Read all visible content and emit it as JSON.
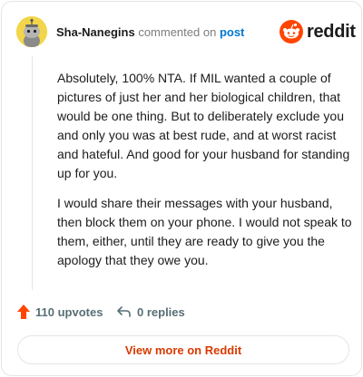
{
  "header": {
    "username": "Sha-Nanegins",
    "action_text": "commented on",
    "post_link": "post",
    "brand": "reddit"
  },
  "comment": {
    "paragraphs": [
      "Absolutely, 100% NTA. If MIL wanted a couple of pictures of just her and her biological children, that would be one thing. But to deliberately exclude you and only you was at best rude, and at worst racist and hateful. And good for your husband for standing up for you.",
      "I would share their messages with your husband, then block them on your phone. I would not speak to them, either, until they are ready to give you the apology that they owe you."
    ]
  },
  "footer": {
    "upvotes_label": "110 upvotes",
    "replies_label": "0 replies",
    "view_more_label": "View more on Reddit"
  },
  "colors": {
    "accent": "#d93a00",
    "upvote": "#ff4500",
    "link": "#0079d3",
    "avatar_bg": "#f2d54a"
  },
  "icons": {
    "avatar": "snoo-avatar-icon",
    "logo": "reddit-snoo-icon",
    "upvote": "upvote-arrow-icon",
    "reply": "reply-arrow-icon"
  }
}
